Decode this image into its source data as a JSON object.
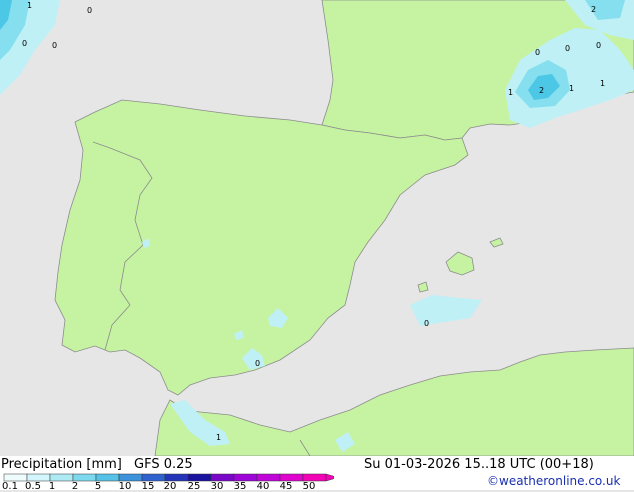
{
  "map": {
    "colors": {
      "sea": "#e6e6e6",
      "land": "#c6f3a2",
      "border": "#888888",
      "light_precip": "#bff0f6",
      "medium_precip": "#86dfee",
      "heavy_precip": "#4cc7e6"
    },
    "contour_labels": [
      "1",
      "0",
      "0",
      "0",
      "2",
      "0",
      "0",
      "0",
      "1",
      "2",
      "1",
      "1",
      "0",
      "0",
      "1"
    ]
  },
  "footer": {
    "title": "Precipitation [mm]",
    "model": "GFS 0.25",
    "valid_time": "Su 01-03-2026 15..18 UTC (00+18)",
    "credit": "©weatheronline.co.uk",
    "scale_ticks": [
      "0.1",
      "0.5",
      "1",
      "2",
      "5",
      "10",
      "15",
      "20",
      "25",
      "30",
      "35",
      "40",
      "45",
      "50"
    ],
    "scale_colors": [
      "#eefcfe",
      "#d2f6fb",
      "#aeeaf4",
      "#7dd9ee",
      "#56c2e7",
      "#3c93dc",
      "#2f62cf",
      "#2434b8",
      "#1a13a0",
      "#7a08c8",
      "#9d05d8",
      "#bf05d8",
      "#e004cf",
      "#f204b6"
    ]
  }
}
